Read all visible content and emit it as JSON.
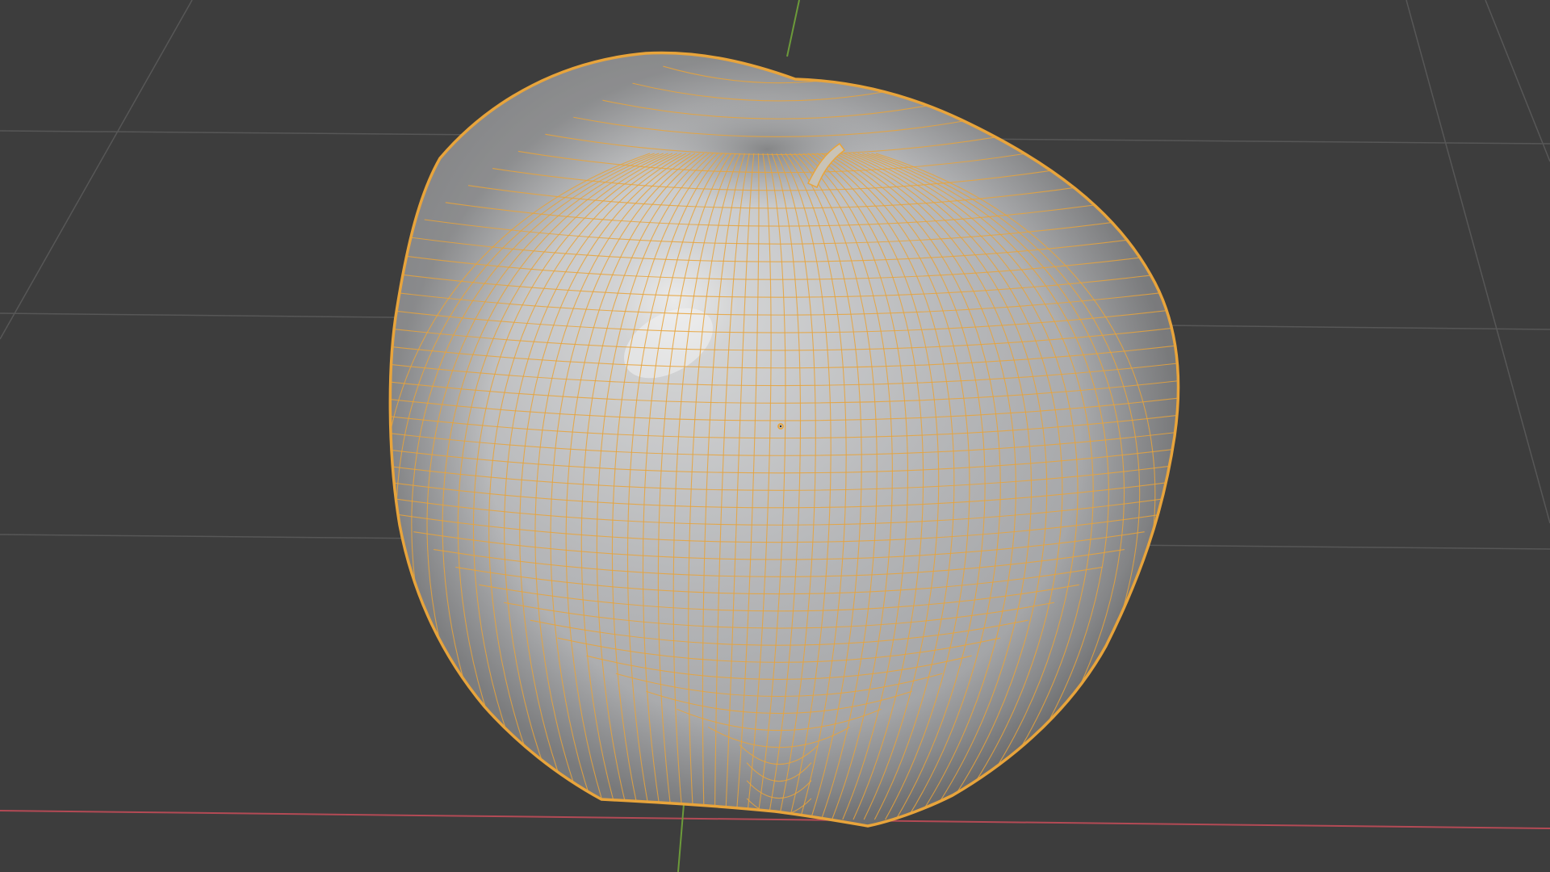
{
  "viewport": {
    "background_color": "#3d3d3d",
    "grid_color": "#575757",
    "x_axis_color": "#b34a55",
    "y_axis_color": "#6c9a3a"
  },
  "object": {
    "shape": "apple",
    "selected": true,
    "surface_color": "#b4b5b7",
    "highlight_color": "#e8e8e8",
    "shadow_color": "#6e6f70",
    "wireframe_color": "#e8a43b",
    "stem_color": "#c9c3b6"
  },
  "origin": {
    "visible": true,
    "color": "#e8a43b"
  }
}
